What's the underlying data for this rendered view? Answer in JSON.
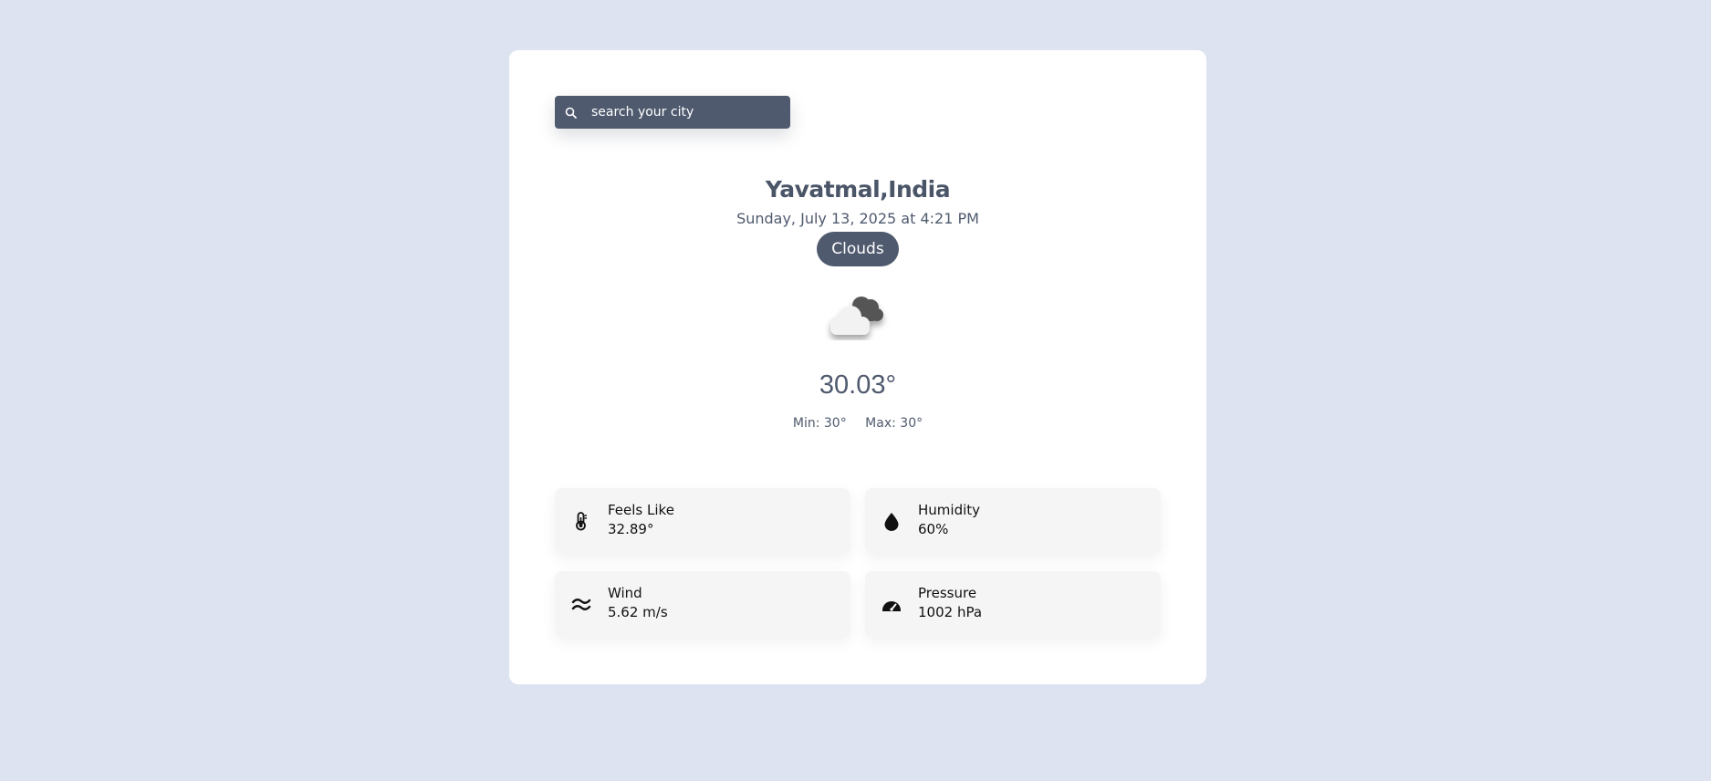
{
  "search": {
    "placeholder": "search your city"
  },
  "location": {
    "name": "Yavatmal,India",
    "datetime": "Sunday, July 13, 2025 at 4:21 PM"
  },
  "weather": {
    "condition": "Clouds",
    "icon": "clouds-icon",
    "temperature": "30.03°",
    "min_label": "Min: 30°",
    "max_label": "Max: 30°"
  },
  "details": [
    {
      "label": "Feels Like",
      "value": "32.89°",
      "icon": "thermometer-icon"
    },
    {
      "label": "Humidity",
      "value": "60%",
      "icon": "water-drop-icon"
    },
    {
      "label": "Wind",
      "value": "5.62 m/s",
      "icon": "wind-icon"
    },
    {
      "label": "Pressure",
      "value": "1002 hPa",
      "icon": "gauge-icon"
    }
  ],
  "colors": {
    "background": "#dde3f0",
    "card": "#ffffff",
    "accent": "#4f5a6e",
    "tile": "#f5f5f5"
  }
}
